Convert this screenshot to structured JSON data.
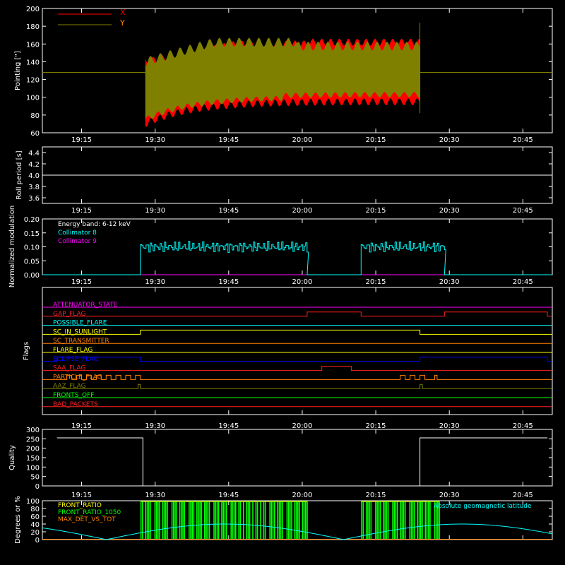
{
  "chart_data": [
    {
      "type": "line",
      "ylabel": "Pointing [\"]",
      "ylim": [
        60,
        200
      ],
      "yticks": [
        60,
        80,
        100,
        120,
        140,
        160,
        180,
        200
      ],
      "xticks": [
        "19:15",
        "19:30",
        "19:45",
        "20:00",
        "20:15",
        "20:30",
        "20:45"
      ],
      "series": [
        {
          "name": "X",
          "color": "#ff0000"
        },
        {
          "name": "Y",
          "color": "#808000"
        }
      ],
      "baseline_value": 128,
      "active_span": [
        "19:28",
        "20:24"
      ]
    },
    {
      "type": "line",
      "ylabel": "Roll period [s]",
      "ylim": [
        3.5,
        4.5
      ],
      "yticks": [
        3.6,
        3.8,
        4.0,
        4.2,
        4.4
      ],
      "yticklabels": [
        "3.6",
        "3.8",
        "4.0",
        "4.2",
        "4.4"
      ],
      "xticks": [
        "19:15",
        "19:30",
        "19:45",
        "20:00",
        "20:15",
        "20:30",
        "20:45"
      ],
      "value": 4.0
    },
    {
      "type": "line",
      "ylabel": "Normalized modulation",
      "ylim": [
        0,
        0.2
      ],
      "yticks": [
        0.0,
        0.05,
        0.1,
        0.15,
        0.2
      ],
      "yticklabels": [
        "0.00",
        "0.05",
        "0.10",
        "0.15",
        "0.20"
      ],
      "xticks": [
        "19:15",
        "19:30",
        "19:45",
        "20:00",
        "20:15",
        "20:30",
        "20:45"
      ],
      "legend_title": "Energy band: 6-12 keV",
      "series": [
        {
          "name": "Collimator 8",
          "color": "#00ffff",
          "segments": [
            [
              "19:27",
              "20:01"
            ],
            [
              "20:12",
              "20:29"
            ]
          ],
          "mean": 0.1
        },
        {
          "name": "Collimator 9",
          "color": "#ff00ff",
          "value": 0.0
        }
      ]
    },
    {
      "type": "line",
      "ylabel": "Flags",
      "xticks": [
        "19:15",
        "19:30",
        "19:45",
        "20:00",
        "20:15",
        "20:30",
        "20:45"
      ],
      "flags": [
        {
          "name": "ATTENUATOR_STATE",
          "color": "#ff00ff"
        },
        {
          "name": "GAP_FLAG",
          "color": "#ff2020",
          "on": [
            [
              "20:01",
              "20:12"
            ],
            [
              "20:29",
              "20:50"
            ]
          ]
        },
        {
          "name": "POSSIBLE_FLARE",
          "color": "#00ffff"
        },
        {
          "name": "SC_IN_SUNLIGHT",
          "color": "#ffff00",
          "on": [
            [
              "19:27",
              "20:24"
            ]
          ]
        },
        {
          "name": "SC_TRANSMITTER",
          "color": "#ff8000"
        },
        {
          "name": "FLARE_FLAG",
          "color": "#ffff00"
        },
        {
          "name": "ECLIPSE_FLAG",
          "color": "#0000ff",
          "on": [
            [
              "19:10",
              "19:27"
            ],
            [
              "20:24",
              "20:50"
            ]
          ]
        },
        {
          "name": "SAA_FLAG",
          "color": "#ff2020",
          "on": [
            [
              "20:04",
              "20:10"
            ]
          ]
        },
        {
          "name": "PARTICLE_FLAG",
          "color": "#ff8000",
          "on": [
            [
              "19:12",
              "19:13"
            ],
            [
              "19:14",
              "19:15"
            ],
            [
              "19:16",
              "19:17"
            ],
            [
              "19:18",
              "19:19"
            ],
            [
              "19:20",
              "19:21"
            ],
            [
              "19:22",
              "19:23"
            ],
            [
              "19:24",
              "19:25"
            ],
            [
              "19:26",
              "19:27"
            ],
            [
              "20:20",
              "20:21"
            ],
            [
              "20:22",
              "20:23"
            ],
            [
              "20:24",
              "20:25"
            ],
            [
              "20:27",
              "20:27.5"
            ]
          ]
        },
        {
          "name": "AAZ_FLAG",
          "color": "#808000",
          "on": [
            [
              "19:26.5",
              "19:27"
            ],
            [
              "20:24",
              "20:24.5"
            ]
          ]
        },
        {
          "name": "FRONTS_OFF",
          "color": "#00ff00"
        },
        {
          "name": "BAD_PACKETS",
          "color": "#ff2020"
        }
      ]
    },
    {
      "type": "line",
      "ylabel": "Quality",
      "ylim": [
        0,
        300
      ],
      "yticks": [
        0,
        50,
        100,
        150,
        200,
        250,
        300
      ],
      "xticks": [
        "19:15",
        "19:30",
        "19:45",
        "20:00",
        "20:15",
        "20:30",
        "20:45"
      ],
      "series": [
        {
          "color": "#ffffff",
          "steps": [
            [
              "19:10",
              255
            ],
            [
              "19:27.5",
              0
            ],
            [
              "20:24",
              255
            ],
            [
              "20:50",
              255
            ]
          ]
        }
      ]
    },
    {
      "type": "line",
      "ylabel": "Degrees or %",
      "ylim": [
        0,
        100
      ],
      "yticks": [
        0,
        20,
        40,
        60,
        80,
        100
      ],
      "xticks": [
        "19:15",
        "19:30",
        "19:45",
        "20:00",
        "20:15",
        "20:30",
        "20:45"
      ],
      "series": [
        {
          "name": "FRONT_RATIO",
          "color": "#ffff00"
        },
        {
          "name": "FRONT_RATIO_1050",
          "color": "#00ff00",
          "spans": [
            [
              "19:27",
              "20:01"
            ],
            [
              "20:12",
              "20:28"
            ]
          ]
        },
        {
          "name": "MAX_DET_VS_TOT",
          "color": "#ff8000"
        },
        {
          "name": "Absolute geomagnetic latitude",
          "color": "#00ffff"
        }
      ]
    }
  ]
}
